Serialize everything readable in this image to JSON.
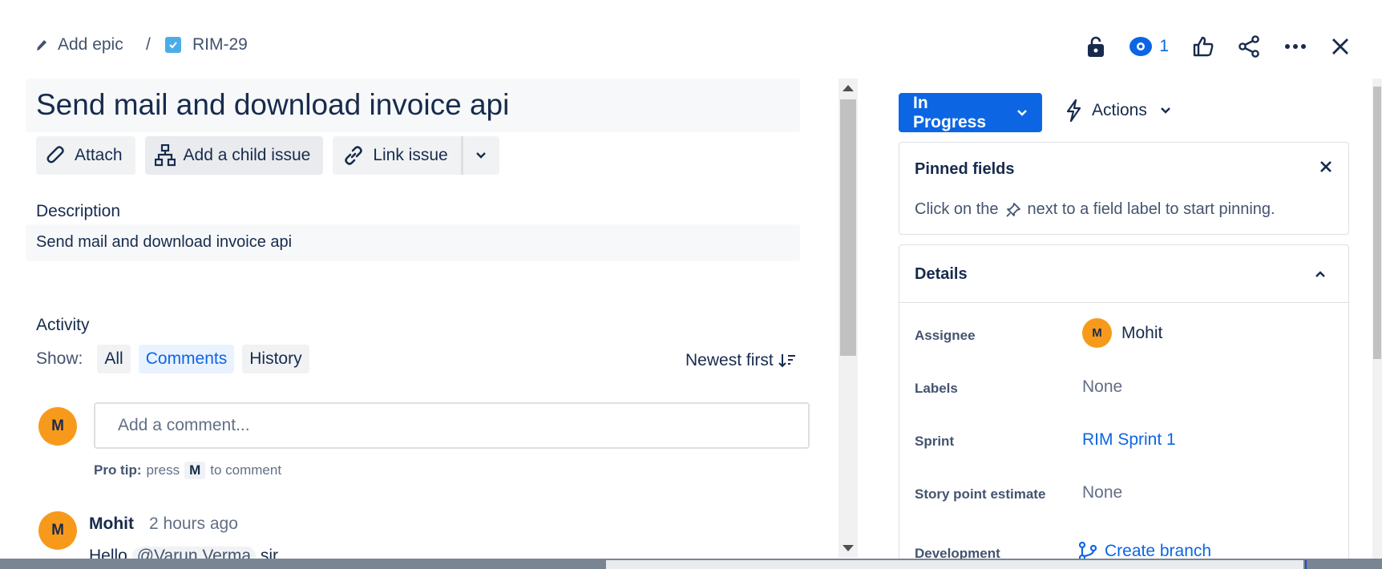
{
  "breadcrumb": {
    "epic_label": "Add epic",
    "separator": "/",
    "issue_key": "RIM-29"
  },
  "top_actions": {
    "watch_count": "1",
    "icons": [
      "lock-icon",
      "eye-icon",
      "thumbs-up-icon",
      "share-icon",
      "more-icon",
      "close-icon"
    ]
  },
  "issue": {
    "title": "Send mail and download invoice api",
    "toolbar": {
      "attach": "Attach",
      "add_child": "Add a child issue",
      "link_issue": "Link issue"
    },
    "description_label": "Description",
    "description": "Send mail and download invoice api"
  },
  "activity": {
    "label": "Activity",
    "show_label": "Show:",
    "filters": [
      "All",
      "Comments",
      "History"
    ],
    "active_filter": "Comments",
    "sort": "Newest first",
    "current_user_initial": "M",
    "comment_placeholder": "Add a comment...",
    "pro_tip": {
      "prefix": "Pro tip:",
      "press": "press",
      "key": "M",
      "suffix": "to comment"
    },
    "comments": [
      {
        "initial": "M",
        "author": "Mohit",
        "time": "2 hours ago",
        "body_start": "Hello",
        "mention": "@Varun Verma",
        "body_end": "sir"
      }
    ]
  },
  "sidebar": {
    "status": "In Progress",
    "actions": "Actions",
    "pinned": {
      "title": "Pinned fields",
      "text_before": "Click on the",
      "text_after": "next to a field label to start pinning."
    },
    "details": {
      "title": "Details",
      "fields": [
        {
          "label": "Assignee",
          "value": "Mohit",
          "initial": "M"
        },
        {
          "label": "Labels",
          "value": "None"
        },
        {
          "label": "Sprint",
          "value": "RIM Sprint 1"
        },
        {
          "label": "Story point estimate",
          "value": "None"
        },
        {
          "label": "Development",
          "value": "Create branch"
        }
      ]
    }
  },
  "colors": {
    "accent": "#0c66e4",
    "avatar": "#f79a1c",
    "checkbox": "#4bade8"
  }
}
